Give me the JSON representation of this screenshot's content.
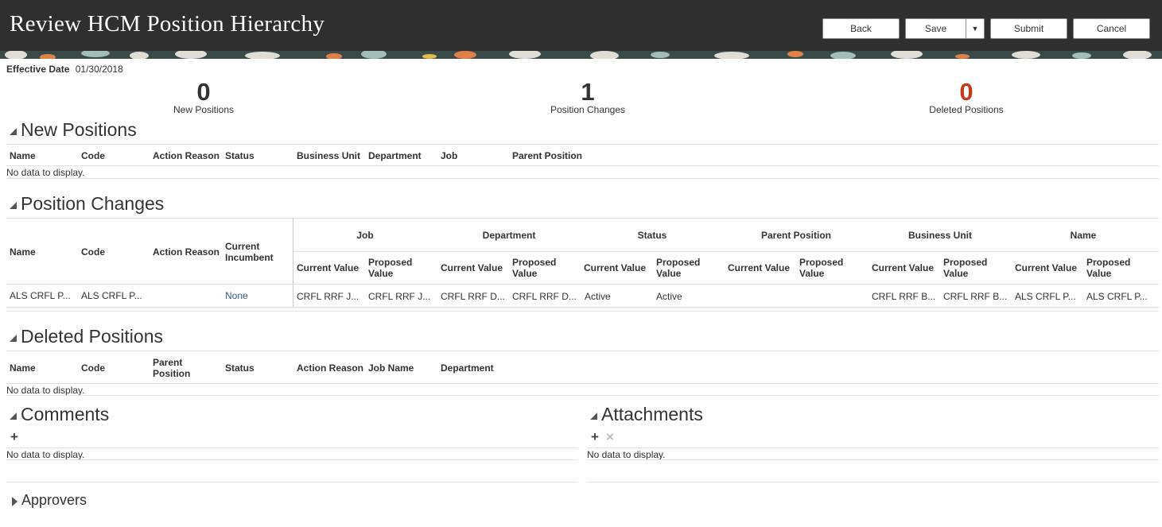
{
  "header": {
    "title": "Review HCM Position Hierarchy",
    "buttons": {
      "back": "Back",
      "save": "Save",
      "submit": "Submit",
      "cancel": "Cancel"
    }
  },
  "effective_date": {
    "label": "Effective Date",
    "value": "01/30/2018"
  },
  "counters": [
    {
      "value": "0",
      "label": "New Positions"
    },
    {
      "value": "1",
      "label": "Position Changes"
    },
    {
      "value": "0",
      "label": "Deleted Positions"
    }
  ],
  "new_positions": {
    "title": "New Positions",
    "columns": [
      "Name",
      "Code",
      "Action Reason",
      "Status",
      "Business Unit",
      "Department",
      "Job",
      "Parent Position"
    ],
    "empty_text": "No data to display."
  },
  "position_changes": {
    "title": "Position Changes",
    "fixed_columns": [
      "Name",
      "Code",
      "Action Reason",
      "Current Incumbent"
    ],
    "groups": [
      "Job",
      "Department",
      "Status",
      "Parent Position",
      "Business Unit",
      "Name"
    ],
    "sub_current": "Current Value",
    "sub_proposed": "Proposed Value",
    "row": {
      "name": "ALS CRFL P...",
      "code": "ALS CRFL P...",
      "action_reason": "",
      "current_incumbent": "None",
      "values": [
        "CRFL RRF J...",
        "CRFL RRF J...",
        "CRFL RRF D...",
        "CRFL RRF D...",
        "Active",
        "Active",
        "",
        "",
        "CRFL RRF B...",
        "CRFL RRF B...",
        "ALS CRFL P...",
        "ALS CRFL P..."
      ]
    }
  },
  "deleted_positions": {
    "title": "Deleted Positions",
    "columns": [
      "Name",
      "Code",
      "Parent Position",
      "Status",
      "Action Reason",
      "Job Name",
      "Department"
    ],
    "empty_text": "No data to display."
  },
  "comments": {
    "title": "Comments",
    "empty_text": "No data to display."
  },
  "attachments": {
    "title": "Attachments",
    "empty_text": "No data to display."
  },
  "approvers": {
    "title": "Approvers"
  },
  "colors": {
    "header_bg": "#2f2f2f",
    "accent_red": "#c7391a",
    "link": "#3a5f84"
  }
}
